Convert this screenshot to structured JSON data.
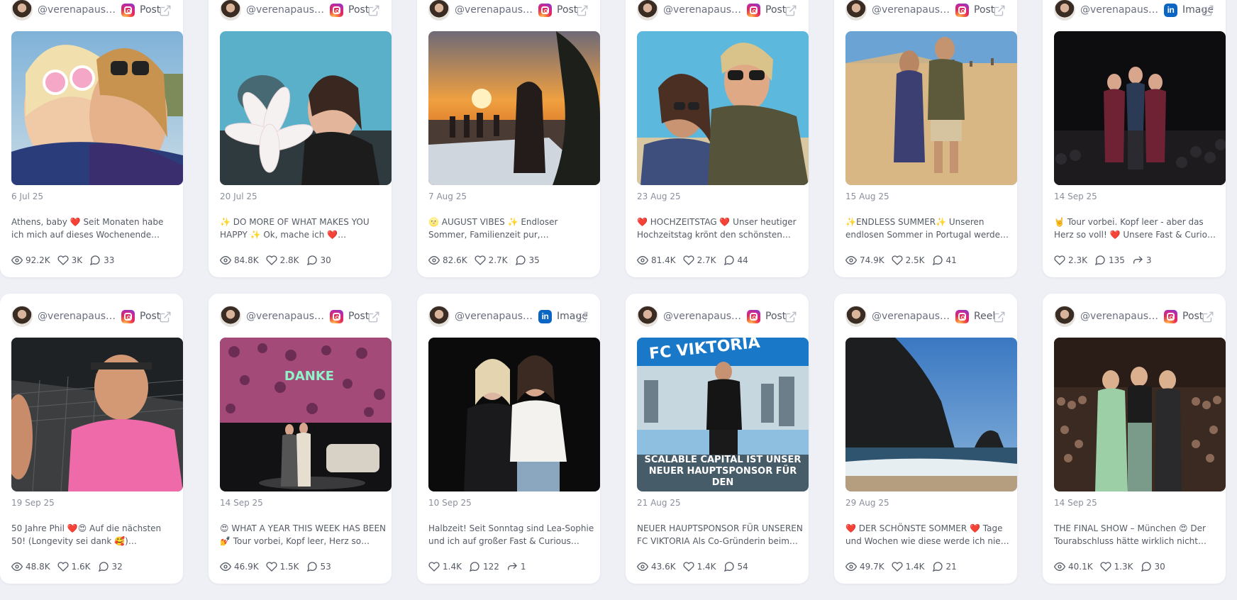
{
  "posts": [
    {
      "handle": "@verenapausder",
      "platform": "instagram",
      "platform_label": "Post",
      "date": "6 Jul 25",
      "caption": "Athens, baby ❤️ Seit Monaten habe ich mich auf dieses Wochenende und…",
      "stats": [
        {
          "icon": "eye-icon",
          "value": "92.2K"
        },
        {
          "icon": "heart-icon",
          "value": "3K"
        },
        {
          "icon": "comment-icon",
          "value": "33"
        }
      ]
    },
    {
      "handle": "@verenapausder",
      "platform": "instagram",
      "platform_label": "Post",
      "date": "20 Jul 25",
      "caption": "✨ DO MORE OF WHAT MAKES YOU HAPPY ✨ Ok, mache ich ❤️ #happytimes",
      "stats": [
        {
          "icon": "eye-icon",
          "value": "84.8K"
        },
        {
          "icon": "heart-icon",
          "value": "2.8K"
        },
        {
          "icon": "comment-icon",
          "value": "30"
        }
      ]
    },
    {
      "handle": "@verenapausder",
      "platform": "instagram",
      "platform_label": "Post",
      "date": "7 Aug 25",
      "caption": "🌝 AUGUST VIBES ✨ Endloser Sommer, Familienzeit pur, Sonnenuntergänge,…",
      "stats": [
        {
          "icon": "eye-icon",
          "value": "82.6K"
        },
        {
          "icon": "heart-icon",
          "value": "2.7K"
        },
        {
          "icon": "comment-icon",
          "value": "35"
        }
      ]
    },
    {
      "handle": "@verenapausder",
      "platform": "instagram",
      "platform_label": "Post",
      "date": "23 Aug 25",
      "caption": "❤️ HOCHZEITSTAG ❤️ Unser heutiger Hochzeitstag krönt den schönsten…",
      "stats": [
        {
          "icon": "eye-icon",
          "value": "81.4K"
        },
        {
          "icon": "heart-icon",
          "value": "2.7K"
        },
        {
          "icon": "comment-icon",
          "value": "44"
        }
      ]
    },
    {
      "handle": "@verenapausder",
      "platform": "instagram",
      "platform_label": "Post",
      "date": "15 Aug 25",
      "caption": "✨ENDLESS SUMMER✨ Unseren endlosen Sommer in Portugal werde ich nie…",
      "stats": [
        {
          "icon": "eye-icon",
          "value": "74.9K"
        },
        {
          "icon": "heart-icon",
          "value": "2.5K"
        },
        {
          "icon": "comment-icon",
          "value": "41"
        }
      ]
    },
    {
      "handle": "@verenapaus…",
      "platform": "linkedin",
      "platform_label": "Image",
      "date": "14 Sep 25",
      "caption": "🤘 Tour vorbei. Kopf leer - aber das Herz so voll! ❤️ Unsere Fast & Curious Podca…",
      "stats": [
        {
          "icon": "heart-icon",
          "value": "2.3K"
        },
        {
          "icon": "comment-icon",
          "value": "135"
        },
        {
          "icon": "share-icon",
          "value": "3"
        }
      ]
    },
    {
      "handle": "@verenapausder",
      "platform": "instagram",
      "platform_label": "Post",
      "date": "19 Sep 25",
      "caption": "50 Jahre Phil ❤️😍 Auf die nächsten 50! (Longevity sei dank 🥰) #happyday…",
      "stats": [
        {
          "icon": "eye-icon",
          "value": "48.8K"
        },
        {
          "icon": "heart-icon",
          "value": "1.6K"
        },
        {
          "icon": "comment-icon",
          "value": "32"
        }
      ]
    },
    {
      "handle": "@verenapausder",
      "platform": "instagram",
      "platform_label": "Post",
      "date": "14 Sep 25",
      "caption": "😍 WHAT A YEAR THIS WEEK HAS BEEN 💅 Tour vorbei, Kopf leer, Herz so voll!!! ❤️…",
      "stats": [
        {
          "icon": "eye-icon",
          "value": "46.9K"
        },
        {
          "icon": "heart-icon",
          "value": "1.5K"
        },
        {
          "icon": "comment-icon",
          "value": "53"
        }
      ]
    },
    {
      "handle": "@verenapaus…",
      "platform": "linkedin",
      "platform_label": "Image",
      "date": "10 Sep 25",
      "caption": "Halbzeit! Seit Sonntag sind Lea-Sophie und ich auf großer Fast & Curious…",
      "stats": [
        {
          "icon": "heart-icon",
          "value": "1.4K"
        },
        {
          "icon": "comment-icon",
          "value": "122"
        },
        {
          "icon": "share-icon",
          "value": "1"
        }
      ]
    },
    {
      "handle": "@verenapausder",
      "platform": "instagram",
      "platform_label": "Post",
      "date": "21 Aug 25",
      "caption": "NEUER HAUPTSPONSOR FÜR UNSEREN FC VIKTORIA Als Co-Gründerin beim…",
      "image_text": "SCALABLE CAPITAL IST UNSER NEUER HAUPTSPONSOR FÜR DEN",
      "image_text_top": "FC VIKTORIA",
      "stats": [
        {
          "icon": "eye-icon",
          "value": "43.6K"
        },
        {
          "icon": "heart-icon",
          "value": "1.4K"
        },
        {
          "icon": "comment-icon",
          "value": "54"
        }
      ]
    },
    {
      "handle": "@verenapausder",
      "platform": "instagram",
      "platform_label": "Reel",
      "date": "29 Aug 25",
      "caption": "❤️ DER SCHÖNSTE SOMMER ❤️ Tage und Wochen wie diese werde ich nie…",
      "stats": [
        {
          "icon": "eye-icon",
          "value": "49.7K"
        },
        {
          "icon": "heart-icon",
          "value": "1.4K"
        },
        {
          "icon": "comment-icon",
          "value": "21"
        }
      ]
    },
    {
      "handle": "@verenapausder",
      "platform": "instagram",
      "platform_label": "Post",
      "date": "14 Sep 25",
      "caption": "THE FINAL SHOW – München 😍 Der Tourabschluss hätte wirklich nicht…",
      "stats": [
        {
          "icon": "eye-icon",
          "value": "40.1K"
        },
        {
          "icon": "heart-icon",
          "value": "1.3K"
        },
        {
          "icon": "comment-icon",
          "value": "30"
        }
      ]
    }
  ],
  "danke_text": "DANKE",
  "colors": {
    "background": "#eef0f6",
    "card": "#ffffff",
    "linkedin": "#0a66c2",
    "instagram_accent": "#e6285b"
  }
}
